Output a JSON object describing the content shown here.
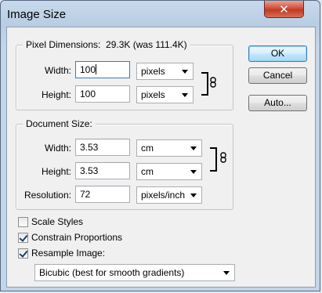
{
  "window": {
    "title": "Image Size",
    "close_label": "✕"
  },
  "pixel_dimensions": {
    "label": "Pixel Dimensions:",
    "size_text": "29.3K (was 111.4K)",
    "width_label": "Width:",
    "width_value": "100",
    "width_unit": "pixels",
    "height_label": "Height:",
    "height_value": "100",
    "height_unit": "pixels"
  },
  "document_size": {
    "label": "Document Size:",
    "width_label": "Width:",
    "width_value": "3.53",
    "width_unit": "cm",
    "height_label": "Height:",
    "height_value": "3.53",
    "height_unit": "cm",
    "resolution_label": "Resolution:",
    "resolution_value": "72",
    "resolution_unit": "pixels/inch"
  },
  "buttons": {
    "ok": "OK",
    "cancel": "Cancel",
    "auto": "Auto..."
  },
  "options": {
    "scale_styles": {
      "label": "Scale Styles",
      "checked": false
    },
    "constrain_proportions": {
      "label": "Constrain Proportions",
      "checked": true
    },
    "resample_image": {
      "label": "Resample Image:",
      "checked": true
    },
    "resample_method": "Bicubic (best for smooth gradients)"
  }
}
